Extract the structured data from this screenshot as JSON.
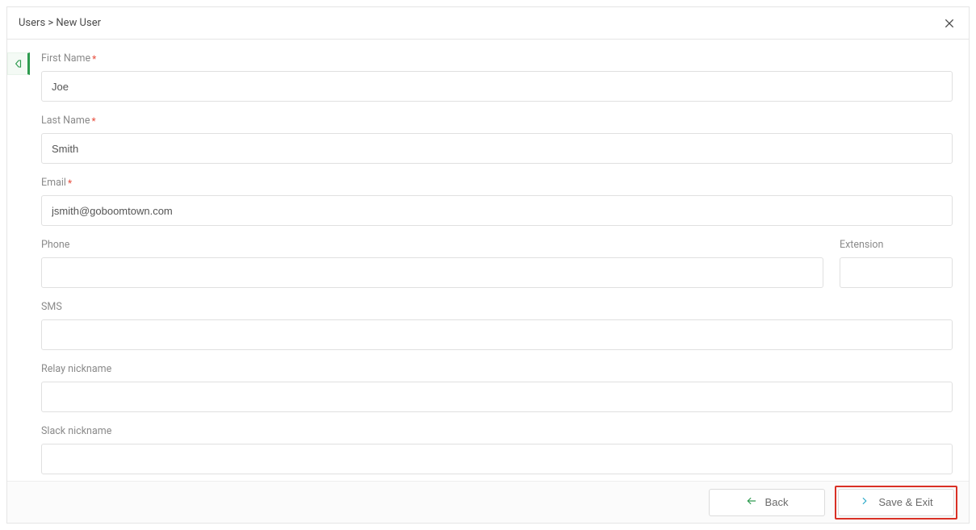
{
  "header": {
    "breadcrumb": "Users > New User"
  },
  "form": {
    "first_name": {
      "label": "First Name",
      "required": true,
      "value": "Joe"
    },
    "last_name": {
      "label": "Last Name",
      "required": true,
      "value": "Smith"
    },
    "email": {
      "label": "Email",
      "required": true,
      "value": "jsmith@goboomtown.com"
    },
    "phone": {
      "label": "Phone",
      "required": false,
      "value": ""
    },
    "extension": {
      "label": "Extension",
      "required": false,
      "value": ""
    },
    "sms": {
      "label": "SMS",
      "required": false,
      "value": ""
    },
    "relay_nickname": {
      "label": "Relay nickname",
      "required": false,
      "value": ""
    },
    "slack_nickname": {
      "label": "Slack nickname",
      "required": false,
      "value": ""
    }
  },
  "footer": {
    "back_label": "Back",
    "save_exit_label": "Save & Exit"
  },
  "required_mark": "*"
}
